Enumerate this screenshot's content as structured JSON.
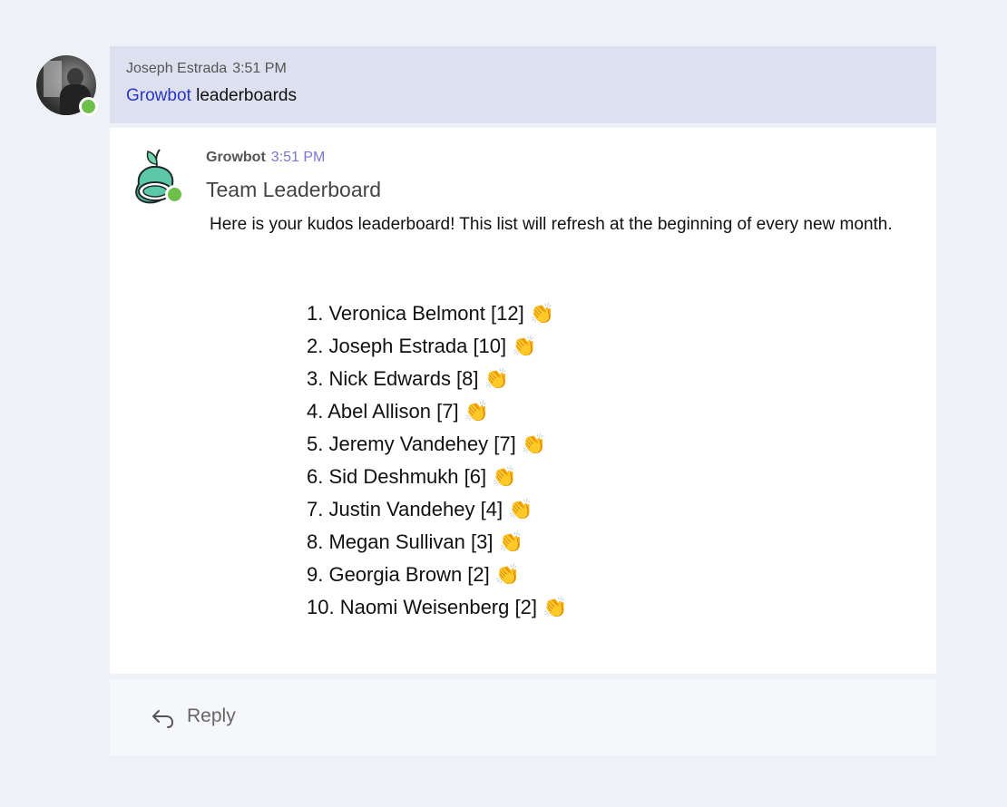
{
  "user_message": {
    "author": "Joseph Estrada",
    "time": "3:51 PM",
    "mention": "Growbot",
    "text": " leaderboards",
    "avatar_icon": "user-photo"
  },
  "bot_message": {
    "author": "Growbot",
    "time": "3:51 PM",
    "heading": "Team Leaderboard",
    "intro": "Here is your kudos leaderboard! This list will refresh at the beginning of every new month.",
    "avatar_icon": "growbot-logo",
    "leaderboard": [
      {
        "text": "1. Veronica Belmont [12]",
        "emoji": "👏"
      },
      {
        "text": "2. Joseph Estrada [10]",
        "emoji": "👏"
      },
      {
        "text": "3. Nick Edwards [8]",
        "emoji": "👏"
      },
      {
        "text": "4. Abel Allison [7]",
        "emoji": "👏"
      },
      {
        "text": "5. Jeremy Vandehey [7]",
        "emoji": "👏"
      },
      {
        "text": "6. Sid Deshmukh [6]",
        "emoji": "👏"
      },
      {
        "text": "7. Justin Vandehey [4]",
        "emoji": "👏"
      },
      {
        "text": "8. Megan Sullivan [3]",
        "emoji": "👏"
      },
      {
        "text": "9. Georgia Brown [2]",
        "emoji": "👏"
      },
      {
        "text": "10. Naomi Weisenberg [2]",
        "emoji": "👏"
      }
    ]
  },
  "reply": {
    "label": "Reply",
    "icon": "reply-arrow-icon"
  },
  "colors": {
    "background": "#eef1f6",
    "user_message_bg": "#dde0ef",
    "mention": "#2a36c8",
    "bot_time": "#7a74d6",
    "presence": "#6cc04a",
    "growbot_teal": "#2fb894"
  }
}
